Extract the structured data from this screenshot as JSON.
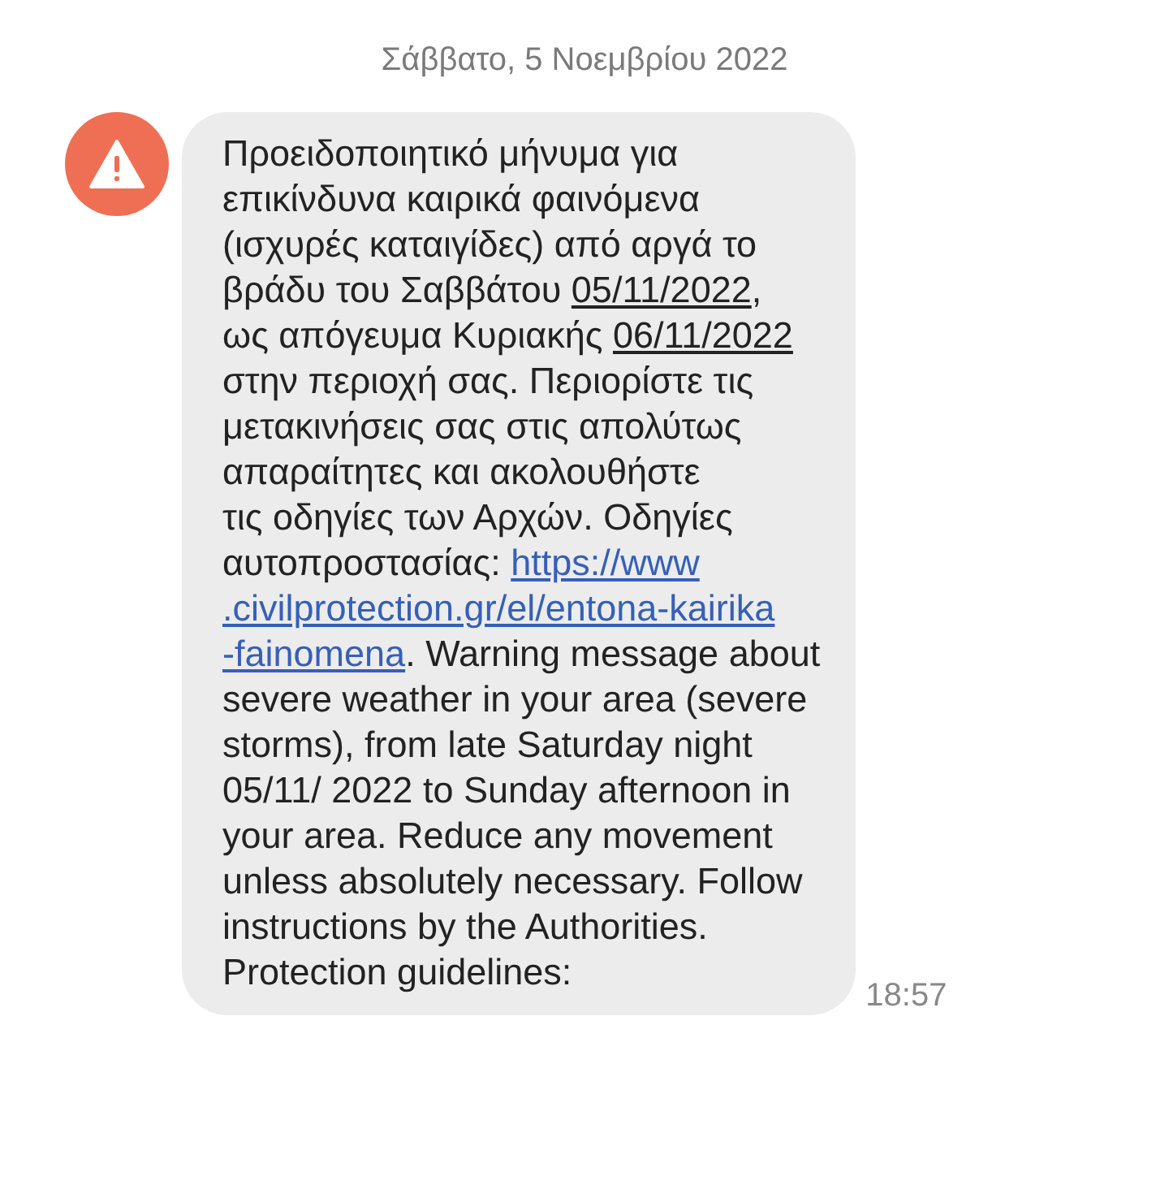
{
  "date_header": "Σάββατο, 5 Νοεμβρίου 2022",
  "message": {
    "time": "18:57",
    "lines": [
      [
        {
          "kind": "text",
          "text": "Προειδοποιητικό μήνυμα για"
        }
      ],
      [
        {
          "kind": "text",
          "text": "επικίνδυνα καιρικά φαινόμενα"
        }
      ],
      [
        {
          "kind": "text",
          "text": "(ισχυρές καταιγίδες) από αργά το"
        }
      ],
      [
        {
          "kind": "text",
          "text": "βράδυ του Σαββάτου "
        },
        {
          "kind": "date",
          "text": "05/11/2022"
        },
        {
          "kind": "text",
          "text": ","
        }
      ],
      [
        {
          "kind": "text",
          "text": "ως απόγευμα Κυριακής "
        },
        {
          "kind": "date",
          "text": "06/11/2022"
        }
      ],
      [
        {
          "kind": "text",
          "text": "στην περιοχή σας. Περιορίστε τις"
        }
      ],
      [
        {
          "kind": "text",
          "text": "μετακινήσεις σας στις απολύτως"
        }
      ],
      [
        {
          "kind": "text",
          "text": "απαραίτητες και ακολουθήστε"
        }
      ],
      [
        {
          "kind": "text",
          "text": "τις οδηγίες των Αρχών. Οδηγίες"
        }
      ],
      [
        {
          "kind": "text",
          "text": "αυτοπροστασίας: "
        },
        {
          "kind": "link",
          "text": "https://www"
        }
      ],
      [
        {
          "kind": "link",
          "text": ".civilprotection.gr/el/entona-kairika"
        }
      ],
      [
        {
          "kind": "link",
          "text": "-fainomena"
        },
        {
          "kind": "text",
          "text": ". Warning message about"
        }
      ],
      [
        {
          "kind": "text",
          "text": "severe weather in your area (severe"
        }
      ],
      [
        {
          "kind": "text",
          "text": "storms), from late Saturday night"
        }
      ],
      [
        {
          "kind": "text",
          "text": "05/11/ 2022 to Sunday afternoon in"
        }
      ],
      [
        {
          "kind": "text",
          "text": "your area. Reduce any movement"
        }
      ],
      [
        {
          "kind": "text",
          "text": "unless absolutely necessary. Follow"
        }
      ],
      [
        {
          "kind": "text",
          "text": "instructions by the Authorities."
        }
      ],
      [
        {
          "kind": "text",
          "text": "Protection guidelines:"
        }
      ]
    ]
  }
}
